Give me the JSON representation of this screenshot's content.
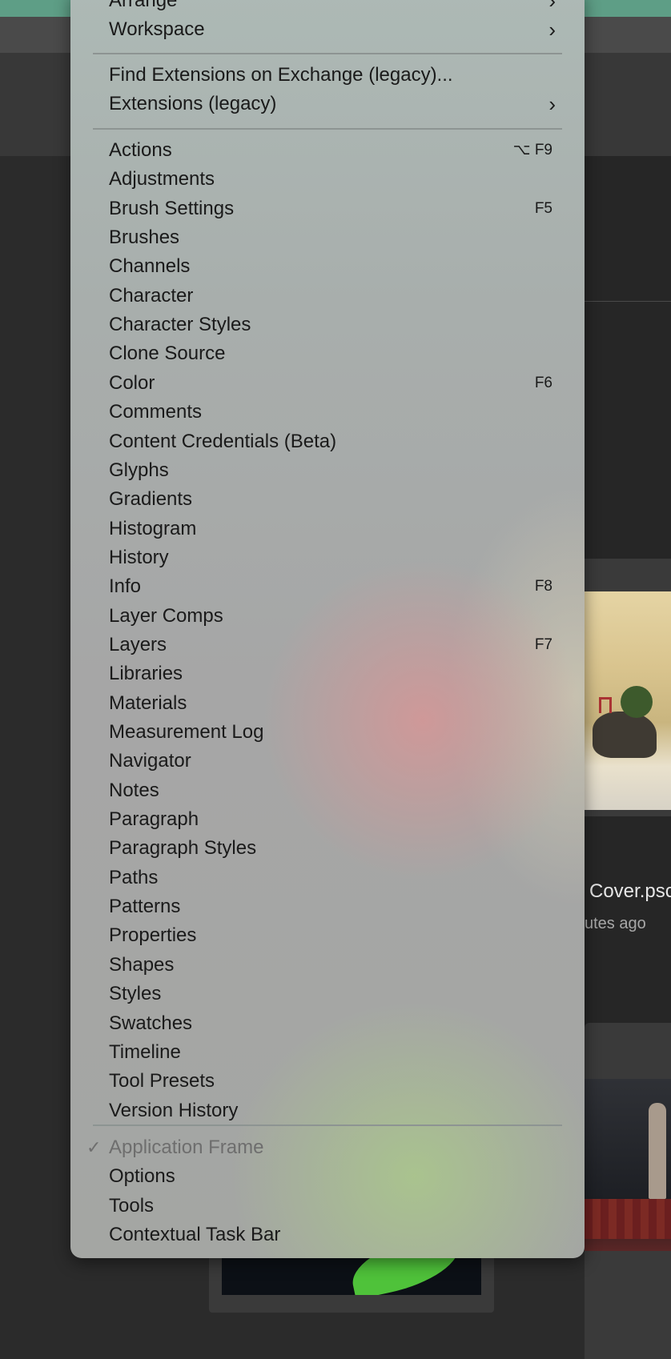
{
  "background": {
    "recent_file_title": "Cover.psc",
    "recent_file_subtitle": "utes ago"
  },
  "menu": {
    "top_items": [
      {
        "label": "Arrange",
        "submenu": true
      },
      {
        "label": "Workspace",
        "submenu": true
      }
    ],
    "extension_items": [
      {
        "label": "Find Extensions on Exchange (legacy)..."
      },
      {
        "label": "Extensions (legacy)",
        "submenu": true
      }
    ],
    "panel_items": [
      {
        "label": "Actions",
        "shortcut": "⌥ F9"
      },
      {
        "label": "Adjustments",
        "shortcut": ""
      },
      {
        "label": "Brush Settings",
        "shortcut": "F5"
      },
      {
        "label": "Brushes",
        "shortcut": ""
      },
      {
        "label": "Channels",
        "shortcut": ""
      },
      {
        "label": "Character",
        "shortcut": ""
      },
      {
        "label": "Character Styles",
        "shortcut": ""
      },
      {
        "label": "Clone Source",
        "shortcut": ""
      },
      {
        "label": "Color",
        "shortcut": "F6"
      },
      {
        "label": "Comments",
        "shortcut": ""
      },
      {
        "label": "Content Credentials (Beta)",
        "shortcut": ""
      },
      {
        "label": "Glyphs",
        "shortcut": ""
      },
      {
        "label": "Gradients",
        "shortcut": ""
      },
      {
        "label": "Histogram",
        "shortcut": ""
      },
      {
        "label": "History",
        "shortcut": ""
      },
      {
        "label": "Info",
        "shortcut": "F8"
      },
      {
        "label": "Layer Comps",
        "shortcut": ""
      },
      {
        "label": "Layers",
        "shortcut": "F7"
      },
      {
        "label": "Libraries",
        "shortcut": ""
      },
      {
        "label": "Materials",
        "shortcut": ""
      },
      {
        "label": "Measurement Log",
        "shortcut": ""
      },
      {
        "label": "Navigator",
        "shortcut": ""
      },
      {
        "label": "Notes",
        "shortcut": ""
      },
      {
        "label": "Paragraph",
        "shortcut": ""
      },
      {
        "label": "Paragraph Styles",
        "shortcut": ""
      },
      {
        "label": "Paths",
        "shortcut": ""
      },
      {
        "label": "Patterns",
        "shortcut": ""
      },
      {
        "label": "Properties",
        "shortcut": ""
      },
      {
        "label": "Shapes",
        "shortcut": ""
      },
      {
        "label": "Styles",
        "shortcut": ""
      },
      {
        "label": "Swatches",
        "shortcut": ""
      },
      {
        "label": "Timeline",
        "shortcut": ""
      },
      {
        "label": "Tool Presets",
        "shortcut": ""
      },
      {
        "label": "Version History",
        "shortcut": ""
      }
    ],
    "bottom_items": [
      {
        "label": "Application Frame",
        "checked": true,
        "disabled": true
      },
      {
        "label": "Options"
      },
      {
        "label": "Tools"
      },
      {
        "label": "Contextual Task Bar"
      }
    ],
    "check_glyph": "✓",
    "chevron_glyph": "›"
  }
}
